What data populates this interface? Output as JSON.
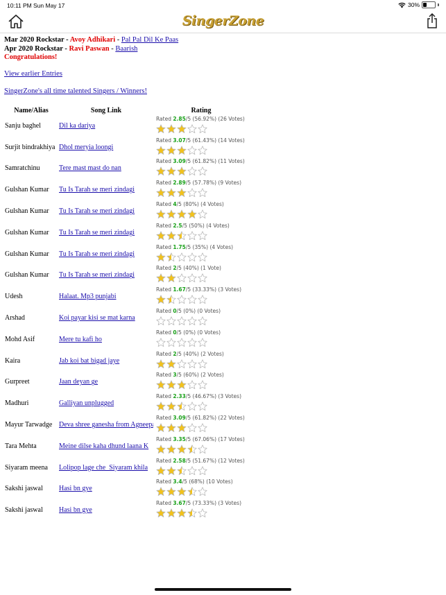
{
  "status_bar": {
    "time": "10:11 PM",
    "date": "Sun May 17",
    "battery": "30%"
  },
  "header": {
    "logo_text": "SingerZone"
  },
  "rockstars": [
    {
      "label": "Mar 2020 Rockstar - ",
      "winner": "Avoy Adhikari",
      "song": "Pal Pal Dil Ke Paas"
    },
    {
      "label": "Apr 2020 Rockstar - ",
      "winner": "Ravi Paswan",
      "song": "Baarish"
    }
  ],
  "separator": " - ",
  "congratulations": "Congratulations!",
  "links": {
    "earlier_entries": "View earlier Entries",
    "all_time": "SingerZone's all time talented Singers / Winners!"
  },
  "table": {
    "headers": {
      "name": "Name/Alias",
      "song": "Song Link",
      "rating": "Rating"
    },
    "rows": [
      {
        "name": "Sanju baghel",
        "song": "Dil ka dariya",
        "score": "2.85",
        "out_of": "/5",
        "detail": " (56.92%) (26 Votes)",
        "rated": "Rated ",
        "stars": 2.85
      },
      {
        "name": "Surjit bindrakhiya",
        "song": "Dhol meryia loongi",
        "score": "3.07",
        "out_of": "/5",
        "detail": " (61.43%) (14 Votes)",
        "rated": "Rated ",
        "stars": 3.07
      },
      {
        "name": "Samratchinu",
        "song": "Tere mast mast do nan",
        "score": "3.09",
        "out_of": "/5",
        "detail": " (61.82%) (11 Votes)",
        "rated": "Rated ",
        "stars": 3.09
      },
      {
        "name": "Gulshan Kumar",
        "song": "Tu Is Tarah se meri zindagi",
        "score": "2.89",
        "out_of": "/5",
        "detail": " (57.78%) (9 Votes)",
        "rated": "Rated ",
        "stars": 2.89
      },
      {
        "name": "Gulshan Kumar",
        "song": "Tu Is Tarah se meri zindagi",
        "score": "4",
        "out_of": "/5",
        "detail": " (80%) (4 Votes)",
        "rated": "Rated ",
        "stars": 4
      },
      {
        "name": "Gulshan Kumar",
        "song": "Tu Is Tarah se meri zindagi",
        "score": "2.5",
        "out_of": "/5",
        "detail": " (50%) (4 Votes)",
        "rated": "Rated ",
        "stars": 2.5
      },
      {
        "name": "Gulshan Kumar",
        "song": "Tu Is Tarah se meri zindagi",
        "score": "1.75",
        "out_of": "/5",
        "detail": " (35%) (4 Votes)",
        "rated": "Rated ",
        "stars": 1.75
      },
      {
        "name": "Gulshan Kumar",
        "song": "Tu Is Tarah se meri zindagi",
        "score": "2",
        "out_of": "/5",
        "detail": " (40%) (1 Vote)",
        "rated": "Rated ",
        "stars": 2
      },
      {
        "name": "Udesh",
        "song": "Halaat. Mp3 punjabi",
        "score": "1.67",
        "out_of": "/5",
        "detail": " (33.33%) (3 Votes)",
        "rated": "Rated ",
        "stars": 1.67
      },
      {
        "name": "Arshad",
        "song": "Koi payar kisi se mat karna",
        "score": "0",
        "out_of": "/5",
        "detail": " (0%) (0 Votes)",
        "rated": "Rated ",
        "stars": 0
      },
      {
        "name": "Mohd Asif",
        "song": "Mere tu kafi ho",
        "score": "0",
        "out_of": "/5",
        "detail": " (0%) (0 Votes)",
        "rated": "Rated ",
        "stars": 0
      },
      {
        "name": "Kaira",
        "song": "Jab koi bat bigad jaye",
        "score": "2",
        "out_of": "/5",
        "detail": " (40%) (2 Votes)",
        "rated": "Rated ",
        "stars": 2
      },
      {
        "name": "Gurpreet",
        "song": "Jaan deyan ge",
        "score": "3",
        "out_of": "/5",
        "detail": " (60%) (2 Votes)",
        "rated": "Rated ",
        "stars": 3
      },
      {
        "name": "Madhuri",
        "song": "Galliyan unplugged",
        "score": "2.33",
        "out_of": "/5",
        "detail": " (46.67%) (3 Votes)",
        "rated": "Rated ",
        "stars": 2.33
      },
      {
        "name": "Mayur Tarwadge",
        "song": "Deva shree ganesha from Agneepath",
        "score": "3.09",
        "out_of": "/5",
        "detail": " (61.82%) (22 Votes)",
        "rated": "Rated ",
        "stars": 3.09
      },
      {
        "name": "Tara Mehta",
        "song": "Meine dilse kaha dhund laana K",
        "score": "3.35",
        "out_of": "/5",
        "detail": " (67.06%) (17 Votes)",
        "rated": "Rated ",
        "stars": 3.35
      },
      {
        "name": "Siyaram meena",
        "song": "Lolipop lage che_Siyaram khila",
        "score": "2.58",
        "out_of": "/5",
        "detail": " (51.67%) (12 Votes)",
        "rated": "Rated ",
        "stars": 2.58
      },
      {
        "name": "Sakshi jaswal",
        "song": "Hasi bn gye",
        "score": "3.4",
        "out_of": "/5",
        "detail": " (68%) (10 Votes)",
        "rated": "Rated ",
        "stars": 3.4
      },
      {
        "name": "Sakshi jaswal",
        "song": "Hasi bn gye",
        "score": "3.67",
        "out_of": "/5",
        "detail": " (73.33%) (3 Votes)",
        "rated": "Rated ",
        "stars": 3.67
      }
    ]
  },
  "colors": {
    "winner_red": "#e00000",
    "link_blue": "#1a0dab",
    "score_green": "#19a019",
    "star_gold": "#f2c21b",
    "logo_gold": "#c8a032"
  }
}
